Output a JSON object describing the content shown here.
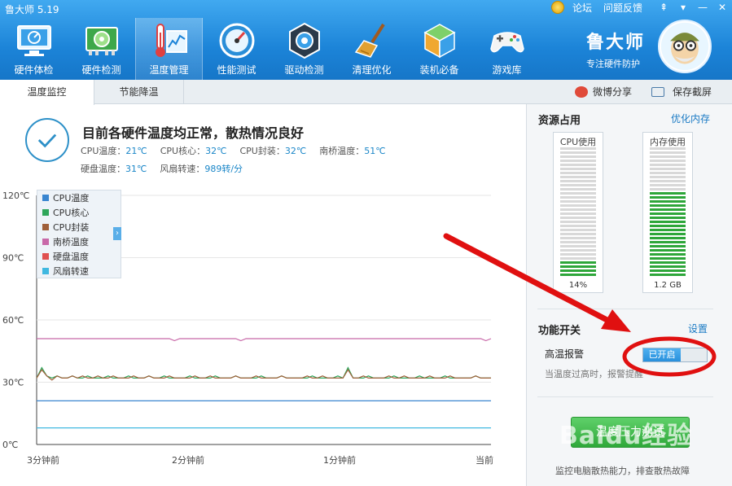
{
  "window": {
    "title": "鲁大师 5.19"
  },
  "top_links": {
    "forum": "论坛",
    "feedback": "问题反馈"
  },
  "toolbar": [
    {
      "label": "硬件体检",
      "icon": "monitor-icon"
    },
    {
      "label": "硬件检测",
      "icon": "circuit-board-icon"
    },
    {
      "label": "温度管理",
      "icon": "thermometer-icon"
    },
    {
      "label": "性能测试",
      "icon": "speedometer-icon"
    },
    {
      "label": "驱动检测",
      "icon": "gear-chip-icon"
    },
    {
      "label": "清理优化",
      "icon": "broom-icon"
    },
    {
      "label": "装机必备",
      "icon": "cube-icon"
    },
    {
      "label": "游戏库",
      "icon": "gamepad-icon"
    }
  ],
  "brand": {
    "name": "鲁大师",
    "slogan": "专注硬件防护"
  },
  "subtabs": {
    "temp_monitor": "温度监控",
    "energy_saving": "节能降温"
  },
  "share": {
    "weibo": "微博分享",
    "screenshot": "保存截屏"
  },
  "status": {
    "title": "目前各硬件温度均正常，散热情况良好",
    "row1": [
      {
        "label": "CPU温度：",
        "value": "21℃"
      },
      {
        "label": "CPU核心：",
        "value": "32℃"
      },
      {
        "label": "CPU封装：",
        "value": "32℃"
      },
      {
        "label": "南桥温度：",
        "value": "51℃"
      }
    ],
    "row2": [
      {
        "label": "硬盘温度：",
        "value": "31℃"
      },
      {
        "label": "风扇转速：",
        "value": "989转/分"
      }
    ]
  },
  "chart_data": {
    "type": "line",
    "y_ticks": [
      "0℃",
      "30℃",
      "60℃",
      "90℃",
      "120℃"
    ],
    "x_ticks": [
      "3分钟前",
      "2分钟前",
      "1分钟前",
      "当前"
    ],
    "ylim": [
      0,
      120
    ],
    "legend_position": "top-left",
    "series": [
      {
        "name": "CPU温度",
        "color": "#3a86d0",
        "values": [
          21,
          21,
          21,
          21,
          21,
          21,
          21,
          21,
          21,
          21,
          21,
          21,
          21,
          21,
          21,
          21,
          21,
          21,
          21,
          21,
          21,
          21,
          21,
          21,
          21,
          21,
          21,
          21,
          21,
          21,
          21,
          21,
          21,
          21,
          21,
          21,
          21,
          21,
          21,
          21,
          21,
          21,
          21,
          21,
          21,
          21,
          21,
          21,
          21,
          21,
          21,
          21,
          21,
          21,
          21,
          21,
          21,
          21,
          21,
          21,
          21,
          21,
          21,
          21,
          21,
          21,
          21,
          21,
          21,
          21,
          21,
          21,
          21,
          21,
          21,
          21,
          21,
          21,
          21,
          21,
          21,
          21,
          21,
          21,
          21,
          21,
          21,
          21,
          21,
          21
        ]
      },
      {
        "name": "CPU核心",
        "color": "#2ea65a",
        "values": [
          32,
          37,
          33,
          32,
          33,
          32,
          32,
          33,
          32,
          32,
          33,
          32,
          32,
          32,
          33,
          32,
          32,
          32,
          33,
          32,
          32,
          32,
          33,
          32,
          32,
          33,
          32,
          32,
          32,
          32,
          33,
          32,
          32,
          32,
          32,
          33,
          32,
          32,
          32,
          33,
          32,
          32,
          32,
          32,
          33,
          32,
          32,
          32,
          33,
          32,
          32,
          32,
          32,
          32,
          33,
          32,
          32,
          32,
          32,
          33,
          32,
          37,
          32,
          32,
          32,
          33,
          32,
          32,
          32,
          32,
          33,
          32,
          32,
          32,
          32,
          33,
          32,
          32,
          32,
          32,
          33,
          32,
          32,
          32,
          32,
          32,
          33,
          32,
          32,
          32
        ]
      },
      {
        "name": "CPU封装",
        "color": "#a0603a",
        "values": [
          32,
          36,
          33,
          31,
          33,
          32,
          32,
          33,
          32,
          33,
          32,
          32,
          33,
          32,
          32,
          33,
          32,
          32,
          32,
          33,
          32,
          32,
          33,
          32,
          32,
          32,
          33,
          32,
          32,
          32,
          32,
          33,
          32,
          32,
          33,
          32,
          32,
          32,
          32,
          33,
          32,
          32,
          32,
          33,
          32,
          32,
          32,
          32,
          33,
          32,
          32,
          32,
          32,
          33,
          32,
          32,
          33,
          32,
          32,
          32,
          32,
          36,
          32,
          32,
          33,
          32,
          32,
          32,
          32,
          33,
          32,
          32,
          33,
          32,
          32,
          32,
          32,
          33,
          32,
          32,
          32,
          33,
          32,
          32,
          32,
          32,
          33,
          32,
          32,
          32
        ]
      },
      {
        "name": "南桥温度",
        "color": "#c868a8",
        "values": [
          51,
          51,
          51,
          51,
          51,
          51,
          51,
          51,
          51,
          51,
          51,
          51,
          51,
          51,
          51,
          51,
          51,
          51,
          51,
          51,
          51,
          51,
          51,
          51,
          51,
          51,
          51,
          50,
          51,
          51,
          51,
          51,
          51,
          51,
          51,
          51,
          51,
          51,
          51,
          51,
          50,
          51,
          51,
          51,
          51,
          51,
          51,
          51,
          51,
          51,
          51,
          51,
          51,
          51,
          51,
          51,
          51,
          51,
          51,
          51,
          51,
          51,
          51,
          51,
          51,
          51,
          51,
          51,
          51,
          51,
          51,
          51,
          51,
          51,
          51,
          51,
          51,
          51,
          51,
          51,
          51,
          51,
          51,
          51,
          51,
          51,
          51,
          51,
          50,
          51
        ]
      },
      {
        "name": "硬盘温度",
        "color": "#e05050",
        "values": []
      },
      {
        "name": "风扇转速",
        "color": "#40b8e0",
        "values": [
          8,
          8,
          8,
          8,
          8,
          8,
          8,
          8,
          8,
          8,
          8,
          8,
          8,
          8,
          8,
          8,
          8,
          8,
          8,
          8,
          8,
          8,
          8,
          8,
          8,
          8,
          8,
          8,
          8,
          8,
          8,
          8,
          8,
          8,
          8,
          8,
          8,
          8,
          8,
          8,
          8,
          8,
          8,
          8,
          8,
          8,
          8,
          8,
          8,
          8,
          8,
          8,
          8,
          8,
          8,
          8,
          8,
          8,
          8,
          8,
          8,
          8,
          8,
          8,
          8,
          8,
          8,
          8,
          8,
          8,
          8,
          8,
          8,
          8,
          8,
          8,
          8,
          8,
          8,
          8,
          8,
          8,
          8,
          8,
          8,
          8,
          8,
          8,
          8,
          8
        ]
      }
    ]
  },
  "side": {
    "resources_title": "资源占用",
    "optimize_link": "优化内存",
    "cpu_label": "CPU使用",
    "cpu_value": "14%",
    "cpu_fill": 0.14,
    "mem_label": "内存使用",
    "mem_value": "1.2 GB",
    "mem_fill": 0.65,
    "func_title": "功能开关",
    "settings_link": "设置",
    "alarm_label": "高温报警",
    "alarm_state": "已开启",
    "alarm_desc": "当温度过高时，报警提醒",
    "big_button": "温度压力测试",
    "bottom_desc": "监控电脑散热能力，排查散热故障"
  },
  "watermark": "Baidu经验",
  "colors": {
    "header": "#1c84d8",
    "accent": "#1a86c8",
    "green": "#2ea63a",
    "annotation": "#e01010"
  }
}
